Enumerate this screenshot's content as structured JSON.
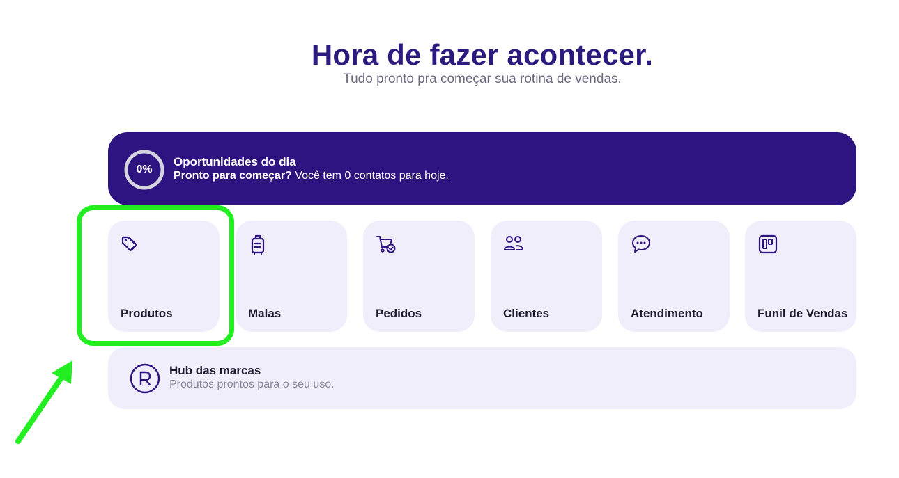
{
  "header": {
    "title": "Hora de fazer acontecer.",
    "subtitle": "Tudo pronto pra começar sua rotina de vendas."
  },
  "banner": {
    "progress": "0%",
    "progress_value": 0,
    "title": "Oportunidades do dia",
    "lead": "Pronto para começar?",
    "message": " Você tem 0 contatos para hoje."
  },
  "cards": [
    {
      "label": "Produtos",
      "icon": "tag-icon"
    },
    {
      "label": "Malas",
      "icon": "luggage-icon"
    },
    {
      "label": "Pedidos",
      "icon": "cart-check-icon"
    },
    {
      "label": "Clientes",
      "icon": "users-icon"
    },
    {
      "label": "Atendimento",
      "icon": "chat-bubble-icon"
    },
    {
      "label": "Funil de Vendas",
      "icon": "kanban-board-icon"
    }
  ],
  "hub": {
    "title": "Hub das marcas",
    "subtitle": "Produtos prontos para o seu uso.",
    "icon": "registered-trademark-icon"
  },
  "colors": {
    "brand_dark": "#2e1480",
    "title": "#2d1a7f",
    "card_bg": "#f1eefc",
    "annotation_green": "#22ee22"
  }
}
